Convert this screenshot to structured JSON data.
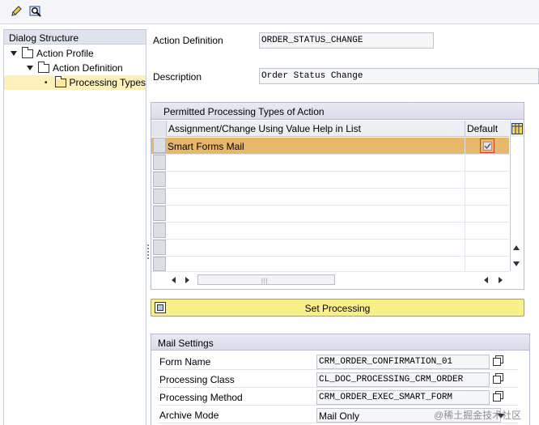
{
  "toolbar": {
    "icons": [
      "edit-pencil-icon",
      "display-magnifier-icon"
    ]
  },
  "tree": {
    "title": "Dialog Structure",
    "items": [
      {
        "label": "Action Profile"
      },
      {
        "label": "Action Definition"
      },
      {
        "label": "Processing Types"
      }
    ]
  },
  "form": {
    "action_definition": {
      "label": "Action Definition",
      "value": "ORDER_STATUS_CHANGE"
    },
    "description": {
      "label": "Description",
      "value": "Order Status Change"
    }
  },
  "table": {
    "title": "Permitted Processing Types of Action",
    "columns": [
      "Assignment/Change Using Value Help in List",
      "Default"
    ],
    "rows": [
      {
        "assignment": "Smart Forms Mail",
        "default": true,
        "selected": true
      }
    ]
  },
  "set_processing": {
    "label": "Set Processing"
  },
  "mail_settings": {
    "title": "Mail Settings",
    "rows": [
      {
        "label": "Form Name",
        "value": "CRM_ORDER_CONFIRMATION_01"
      },
      {
        "label": "Processing Class",
        "value": "CL_DOC_PROCESSING_CRM_ORDER"
      },
      {
        "label": "Processing Method",
        "value": "CRM_ORDER_EXEC_SMART_FORM"
      },
      {
        "label": "Archive Mode",
        "value": "Mail Only"
      }
    ]
  },
  "watermark": "@稀土掘金技术社区",
  "colors": {
    "selected_row": "#e8b86a",
    "button": "#faf08a",
    "header": "#dfe3ee"
  }
}
